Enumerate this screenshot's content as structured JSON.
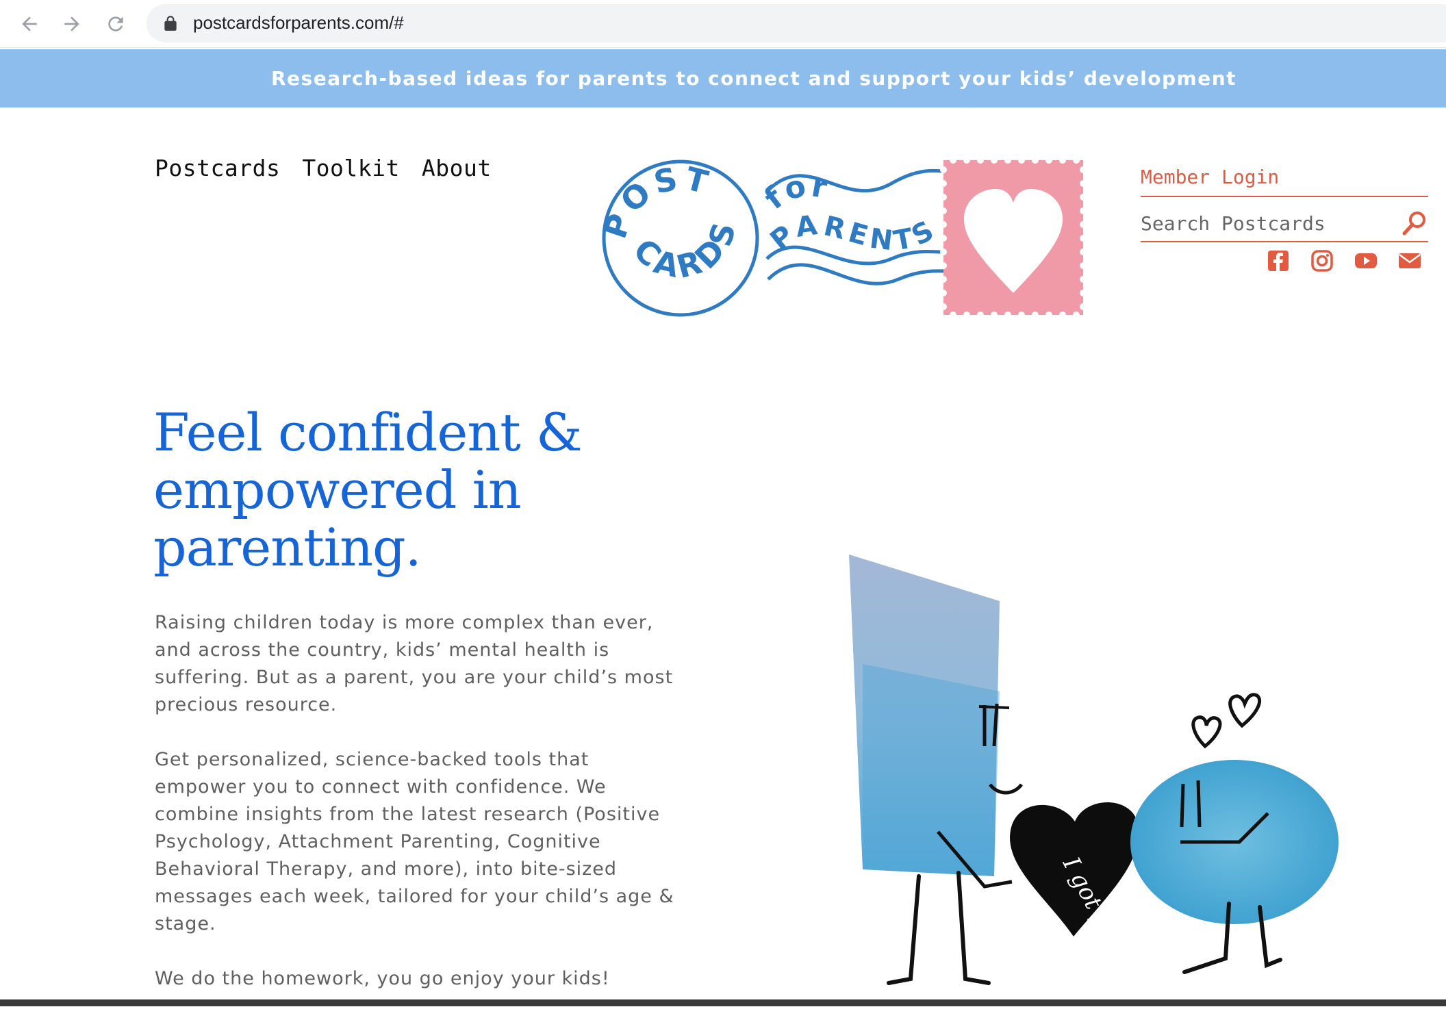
{
  "browser": {
    "url": "postcardsforparents.com/#",
    "back_icon": "arrow-left-icon",
    "forward_icon": "arrow-right-icon",
    "reload_icon": "reload-icon",
    "lock_icon": "lock-icon"
  },
  "banner": {
    "text": "Research-based ideas for parents to connect and support your kids’ development",
    "background": "#8dbdec"
  },
  "nav": {
    "items": [
      {
        "label": "Postcards"
      },
      {
        "label": "Toolkit"
      },
      {
        "label": "About"
      }
    ]
  },
  "logo": {
    "ring_top": "POST",
    "ring_bottom": "CARDS",
    "wave_top": "for",
    "wave_bottom": "PARENTS",
    "stamp_color": "#ef9aa6",
    "ink_color": "#2e7bc4"
  },
  "account": {
    "member_login": "Member Login",
    "search_placeholder": "Search Postcards",
    "accent": "#e25a40"
  },
  "social": [
    "facebook-icon",
    "instagram-icon",
    "youtube-icon",
    "email-icon"
  ],
  "hero": {
    "title": "Feel confident & empowered in parenting.",
    "paragraphs": [
      "Raising children today is more complex than ever, and across the country, kids’ mental health is suffering. But as a parent, you are your child’s most precious resource.",
      "Get personalized, science-backed tools that empower you to connect with confidence. We combine insights from the latest research (Positive Psychology, Attachment Parenting, Cognitive Behavioral Therapy, and more), into bite-sized messages each week, tailored for your child’s age & stage.",
      "We do the homework, you go enjoy your kids!"
    ],
    "illustration_text": "I got you"
  }
}
